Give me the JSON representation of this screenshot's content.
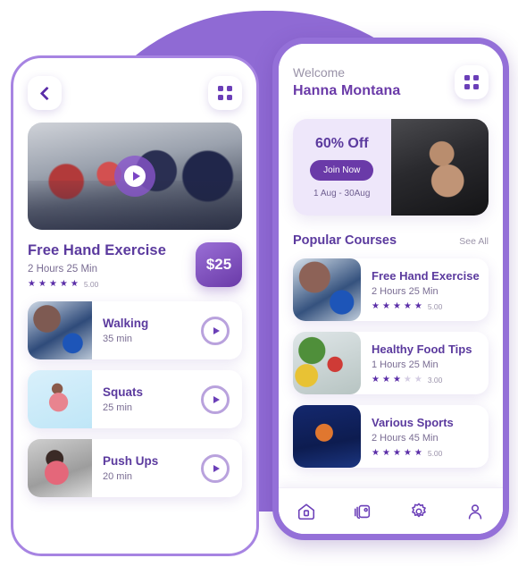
{
  "theme": {
    "brand_purple": "#6a3aa8",
    "accent_light": "#a784e2",
    "blob_purple": "#8f6ad4",
    "muted_text": "#7a6d93",
    "star_filled": "#5b2ea8",
    "star_empty": "#d4cde3"
  },
  "detail_screen": {
    "back_icon": "chevron-left-icon",
    "menu_icon": "grid-menu-icon",
    "hero": {
      "image_alt": "cyclists-racing",
      "play_icon": "play-icon"
    },
    "title": "Free Hand Exercise",
    "duration": "2 Hours 25 Min",
    "rating": {
      "value": "5.00",
      "filled": 5,
      "total": 5
    },
    "price": "$25",
    "exercises": [
      {
        "name": "Walking",
        "duration": "35 min",
        "thumb": "walking",
        "play_icon": "play-icon"
      },
      {
        "name": "Squats",
        "duration": "25 min",
        "thumb": "squats",
        "play_icon": "play-icon"
      },
      {
        "name": "Push Ups",
        "duration": "20 min",
        "thumb": "pushups",
        "play_icon": "play-icon"
      }
    ]
  },
  "home_screen": {
    "welcome_label": "Welcome",
    "user_name": "Hanna Montana",
    "menu_icon": "grid-menu-icon",
    "promo": {
      "discount": "60% Off",
      "cta": "Join Now",
      "dates": "1 Aug - 30Aug",
      "image_alt": "man-lifting-dumbbell-in-gym"
    },
    "section": {
      "title": "Popular Courses",
      "see_all": "See All"
    },
    "courses": [
      {
        "name": "Free Hand Exercise",
        "duration": "2 Hours 25 Min",
        "rating": "5.00",
        "filled": 5,
        "thumb": "shoes"
      },
      {
        "name": "Healthy Food Tips",
        "duration": "1 Hours 25 Min",
        "rating": "3.00",
        "filled": 3,
        "thumb": "veg"
      },
      {
        "name": "Various Sports",
        "duration": "2 Hours 45 Min",
        "rating": "5.00",
        "filled": 5,
        "thumb": "sports"
      }
    ],
    "nav": [
      {
        "icon": "home-icon",
        "label": "Home"
      },
      {
        "icon": "cards-stack-icon",
        "label": "Courses"
      },
      {
        "icon": "gear-icon",
        "label": "Settings"
      },
      {
        "icon": "profile-icon",
        "label": "Profile"
      }
    ]
  }
}
